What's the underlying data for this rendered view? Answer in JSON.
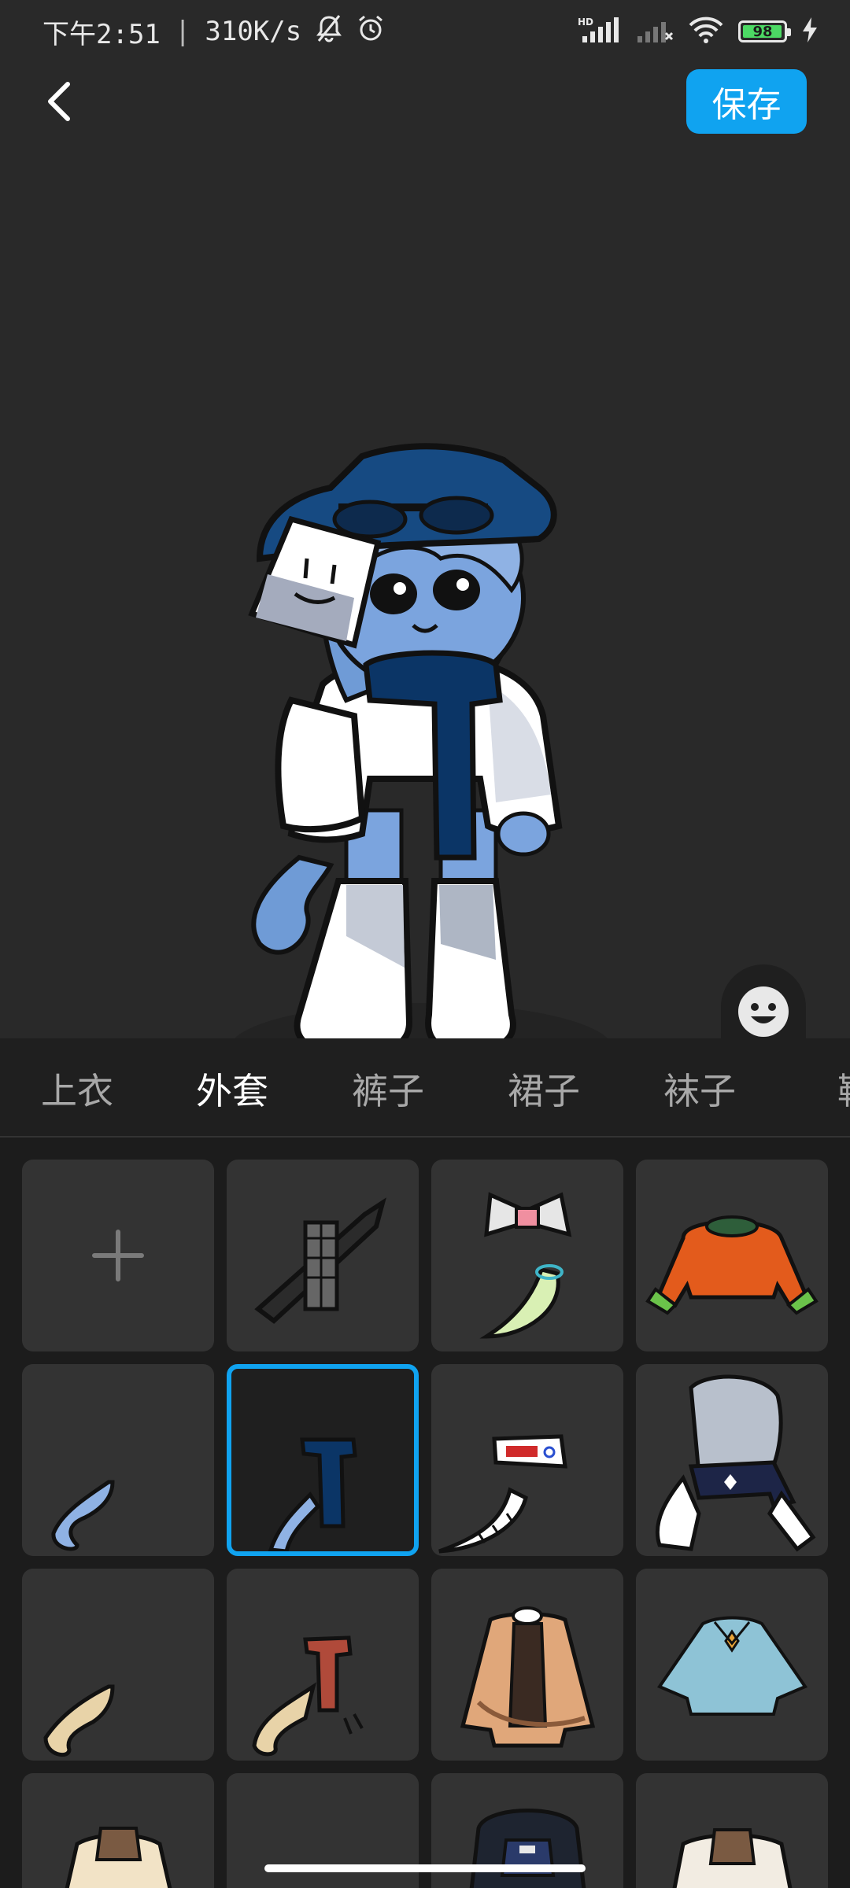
{
  "status_bar": {
    "time": "下午2:51",
    "separator": "|",
    "net_speed": "310K/s",
    "icons": [
      "bell-off-icon",
      "alarm-icon",
      "hd-signal-icon",
      "signal-no-sim-icon",
      "wifi-icon",
      "battery-icon",
      "charging-bolt-icon"
    ],
    "signal_badge": "HD",
    "battery_level": "98",
    "battery_fill_fraction": 0.98
  },
  "header": {
    "back_icon": "chevron-left-icon",
    "save_label": "保存"
  },
  "preview": {
    "side_toggle": [
      "face-icon",
      "shirt-icon"
    ],
    "accent_color": "#10a3f0"
  },
  "tabs": [
    {
      "label": "上衣",
      "active": false
    },
    {
      "label": "外套",
      "active": true
    },
    {
      "label": "裤子",
      "active": false
    },
    {
      "label": "裙子",
      "active": false
    },
    {
      "label": "袜子",
      "active": false
    },
    {
      "label": "鞋",
      "active": false
    }
  ],
  "items": [
    {
      "name": "add-item",
      "icon": "plus-icon",
      "selected": false
    },
    {
      "name": "checked-scarf-sword",
      "selected": false
    },
    {
      "name": "bow-and-feather",
      "selected": false
    },
    {
      "name": "orange-jacket",
      "selected": false
    },
    {
      "name": "blue-tail-ribbon",
      "selected": false
    },
    {
      "name": "navy-scarf",
      "selected": true
    },
    {
      "name": "mask-and-white-tail",
      "selected": false
    },
    {
      "name": "sailor-outfit",
      "selected": false
    },
    {
      "name": "beige-tail",
      "selected": false
    },
    {
      "name": "red-scarf-with-tail",
      "selected": false
    },
    {
      "name": "tan-trench-coat",
      "selected": false
    },
    {
      "name": "light-blue-cape",
      "selected": false
    },
    {
      "name": "cream-coat",
      "selected": false
    },
    {
      "name": "empty-slot",
      "selected": false
    },
    {
      "name": "dark-hooded-coat",
      "selected": false
    },
    {
      "name": "white-brown-coat",
      "selected": false
    }
  ]
}
